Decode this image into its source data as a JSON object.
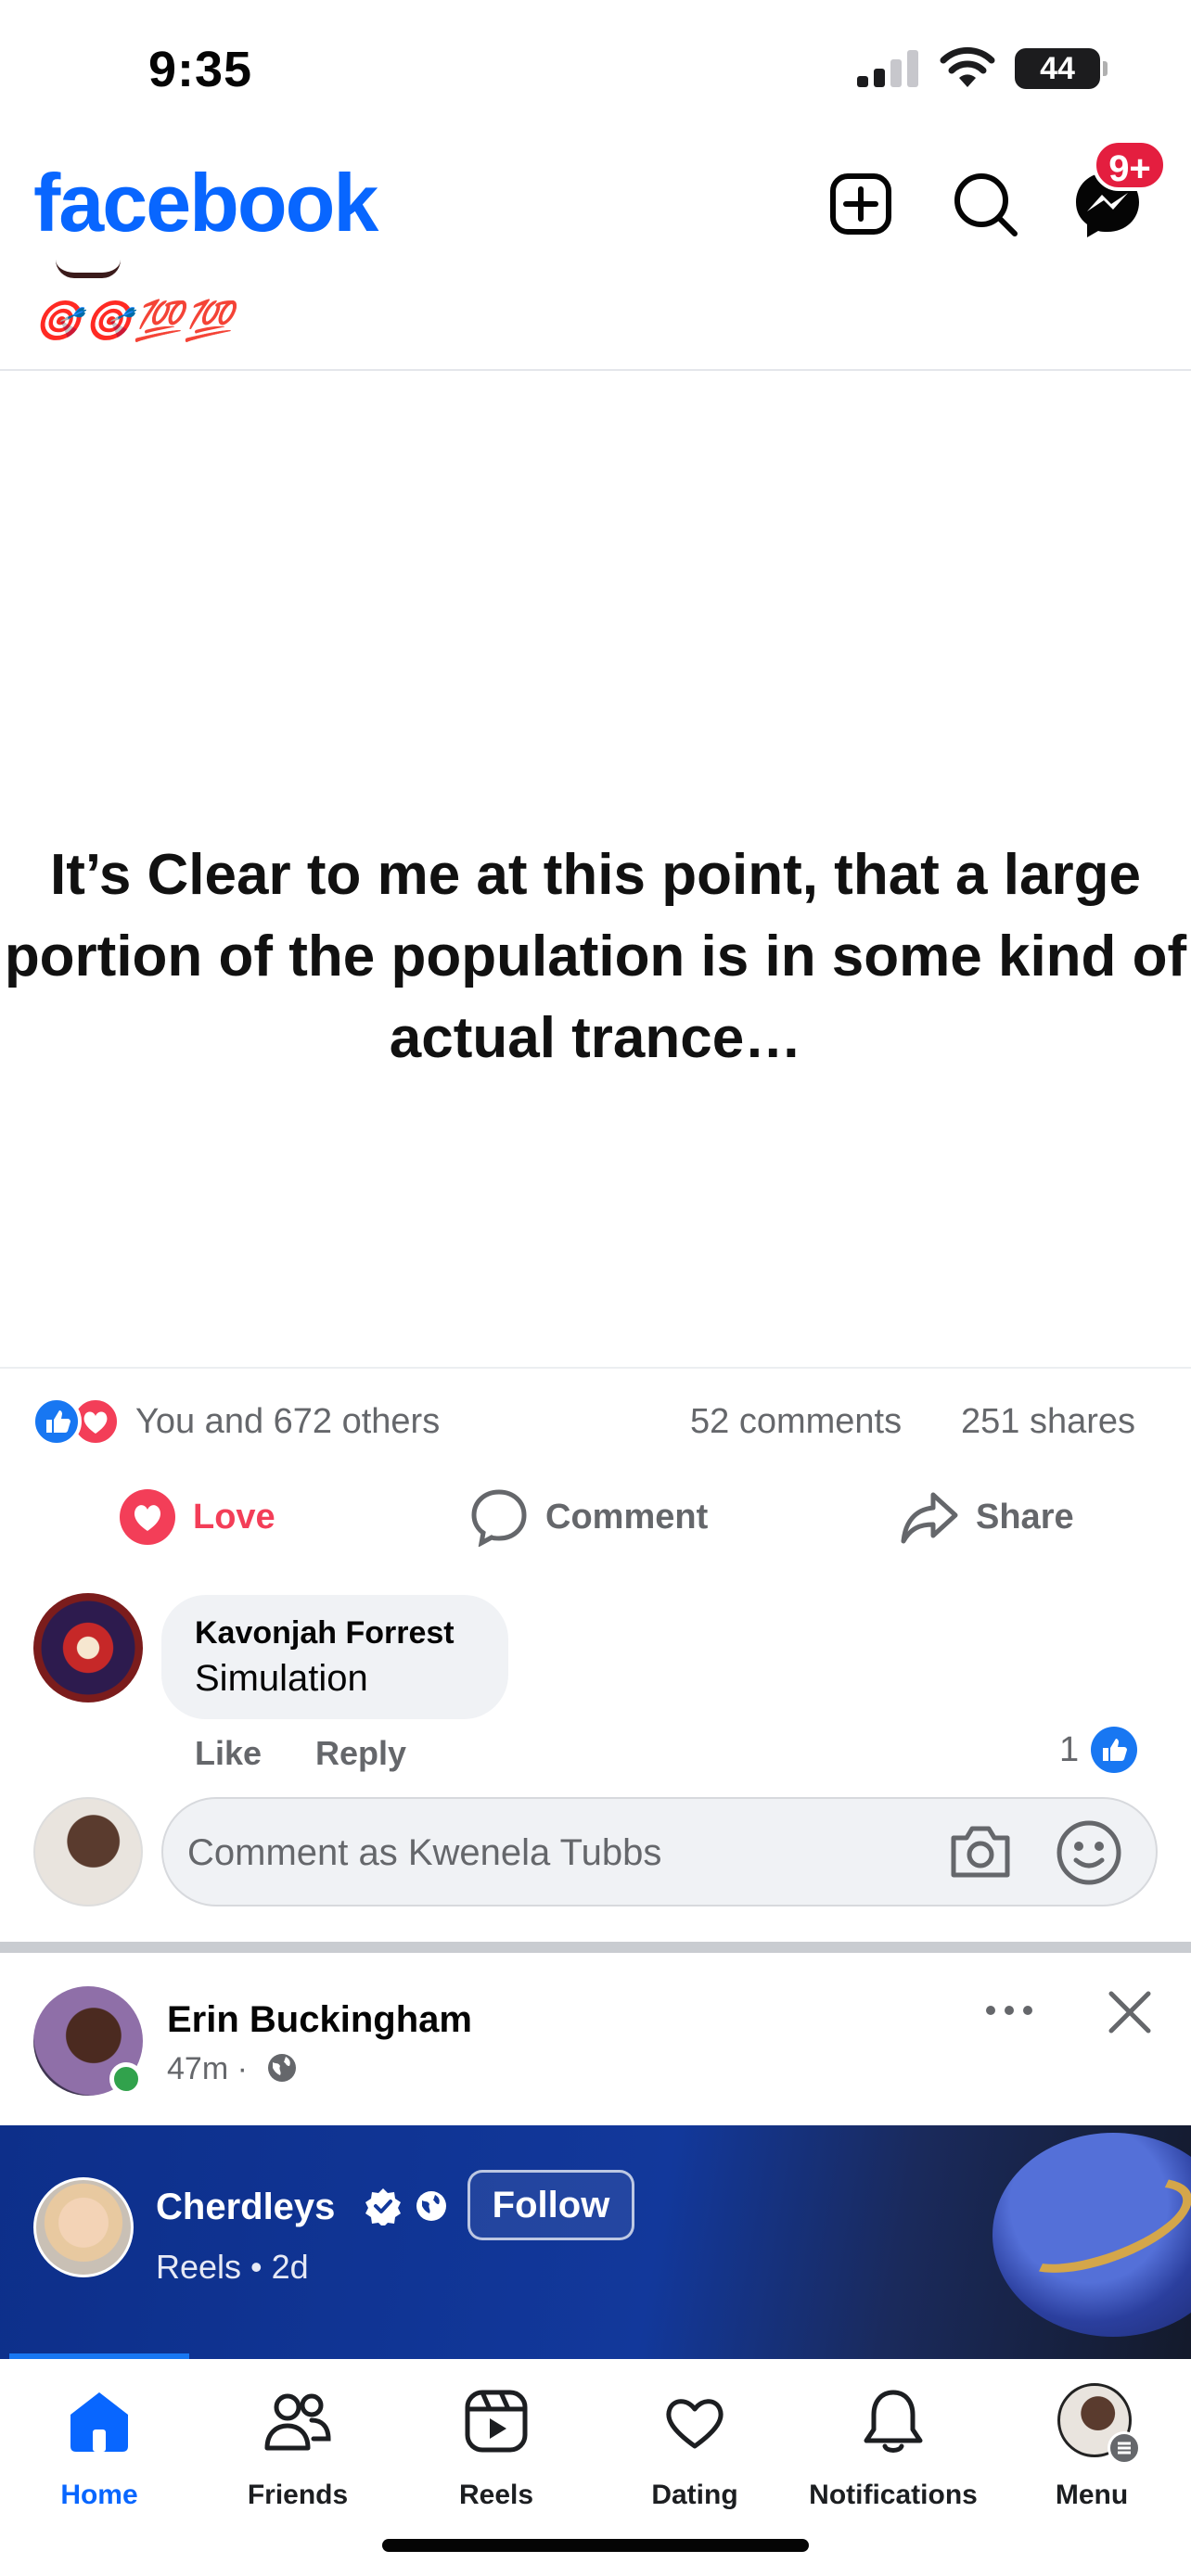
{
  "status_bar": {
    "time": "9:35",
    "battery": "44"
  },
  "header": {
    "logo": "facebook",
    "messenger_badge": "9+"
  },
  "prev_post": {
    "emoji_line": "🎯🎯💯💯"
  },
  "post": {
    "text_image": "It’s Clear to me at this point, that a large portion of the population is in some kind of actual trance…",
    "reactions_text": "You and 672 others",
    "comments_count": "52 comments",
    "shares_count": "251 shares",
    "actions": {
      "love": "Love",
      "comment": "Comment",
      "share": "Share"
    }
  },
  "comment": {
    "author": "Kavonjah Forrest",
    "text": "Simulation",
    "like_label": "Like",
    "reply_label": "Reply",
    "like_count": "1"
  },
  "composer": {
    "placeholder": "Comment as Kwenela Tubbs"
  },
  "next_post": {
    "author": "Erin Buckingham",
    "time": "47m ·",
    "reel": {
      "name": "Cherdleys",
      "follow": "Follow",
      "meta": "Reels • 2d"
    }
  },
  "nav": {
    "home": "Home",
    "friends": "Friends",
    "reels": "Reels",
    "dating": "Dating",
    "notifications": "Notifications",
    "menu": "Menu"
  },
  "colors": {
    "brand": "#0866ff",
    "love": "#f33e58",
    "badge": "#e41e3f",
    "like": "#1877f2"
  }
}
